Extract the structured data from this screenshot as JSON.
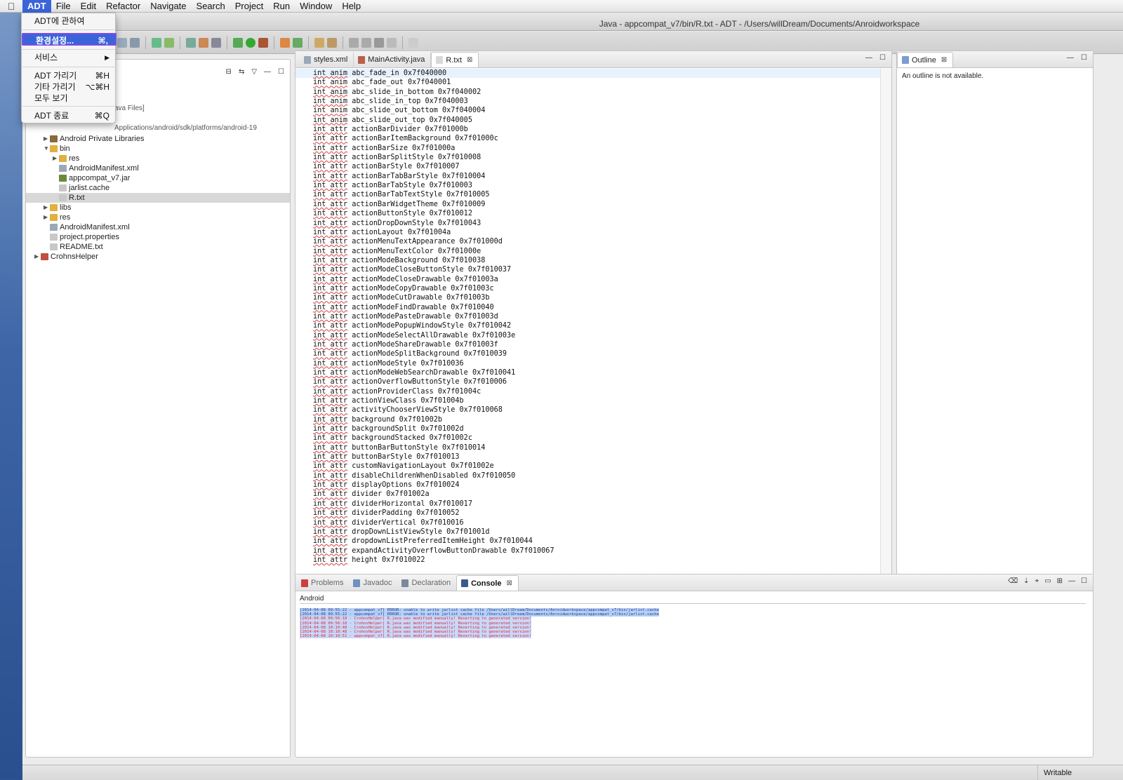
{
  "menubar": {
    "items": [
      "ADT",
      "File",
      "Edit",
      "Refactor",
      "Navigate",
      "Search",
      "Project",
      "Run",
      "Window",
      "Help"
    ]
  },
  "adt_menu": {
    "items": [
      {
        "label": "ADT에 관하여",
        "shortcut": ""
      },
      {
        "label": "환경설정...",
        "shortcut": "⌘,"
      },
      {
        "label": "서비스",
        "shortcut": "▶"
      },
      {
        "label": "ADT 가리기",
        "shortcut": "⌘H"
      },
      {
        "label": "기타 가리기",
        "shortcut": "⌥⌘H"
      },
      {
        "label": "모두 보기",
        "shortcut": ""
      },
      {
        "label": "ADT 종료",
        "shortcut": "⌘Q"
      }
    ]
  },
  "window": {
    "title": "Java - appcompat_v7/bin/R.txt - ADT - /Users/willDream/Documents/Anroidworkspace"
  },
  "explorer": {
    "partial_labels": [
      "ava Files]",
      "Applications/android/sdk/platforms/android-19"
    ],
    "tree": [
      {
        "label": "Android Private Libraries",
        "depth": 2,
        "arrow": "▶",
        "icon": "library"
      },
      {
        "label": "bin",
        "depth": 2,
        "arrow": "▼",
        "icon": "folder"
      },
      {
        "label": "res",
        "depth": 3,
        "arrow": "▶",
        "icon": "folder"
      },
      {
        "label": "AndroidManifest.xml",
        "depth": 3,
        "arrow": "",
        "icon": "xml"
      },
      {
        "label": "appcompat_v7.jar",
        "depth": 3,
        "arrow": "",
        "icon": "jar"
      },
      {
        "label": "jarlist.cache",
        "depth": 3,
        "arrow": "",
        "icon": "file"
      },
      {
        "label": "R.txt",
        "depth": 3,
        "arrow": "",
        "icon": "file",
        "selected": true
      },
      {
        "label": "libs",
        "depth": 2,
        "arrow": "▶",
        "icon": "folder"
      },
      {
        "label": "res",
        "depth": 2,
        "arrow": "▶",
        "icon": "folder"
      },
      {
        "label": "AndroidManifest.xml",
        "depth": 2,
        "arrow": "",
        "icon": "xml"
      },
      {
        "label": "project.properties",
        "depth": 2,
        "arrow": "",
        "icon": "file"
      },
      {
        "label": "README.txt",
        "depth": 2,
        "arrow": "",
        "icon": "file"
      },
      {
        "label": "CrohnsHelper",
        "depth": 1,
        "arrow": "▶",
        "icon": "project"
      }
    ]
  },
  "editor": {
    "tabs": [
      {
        "label": "styles.xml",
        "icon": "xml"
      },
      {
        "label": "MainActivity.java",
        "icon": "java"
      },
      {
        "label": "R.txt",
        "icon": "txt",
        "active": true
      }
    ],
    "lines": [
      [
        "int anim",
        "abc_fade_in 0x7f040000"
      ],
      [
        "int anim",
        "abc_fade_out 0x7f040001"
      ],
      [
        "int anim",
        "abc_slide_in_bottom 0x7f040002"
      ],
      [
        "int anim",
        "abc_slide_in_top 0x7f040003"
      ],
      [
        "int anim",
        "abc_slide_out_bottom 0x7f040004"
      ],
      [
        "int anim",
        "abc_slide_out_top 0x7f040005"
      ],
      [
        "int attr",
        "actionBarDivider 0x7f01000b"
      ],
      [
        "int attr",
        "actionBarItemBackground 0x7f01000c"
      ],
      [
        "int attr",
        "actionBarSize 0x7f01000a"
      ],
      [
        "int attr",
        "actionBarSplitStyle 0x7f010008"
      ],
      [
        "int attr",
        "actionBarStyle 0x7f010007"
      ],
      [
        "int attr",
        "actionBarTabBarStyle 0x7f010004"
      ],
      [
        "int attr",
        "actionBarTabStyle 0x7f010003"
      ],
      [
        "int attr",
        "actionBarTabTextStyle 0x7f010005"
      ],
      [
        "int attr",
        "actionBarWidgetTheme 0x7f010009"
      ],
      [
        "int attr",
        "actionButtonStyle 0x7f010012"
      ],
      [
        "int attr",
        "actionDropDownStyle 0x7f010043"
      ],
      [
        "int attr",
        "actionLayout 0x7f01004a"
      ],
      [
        "int attr",
        "actionMenuTextAppearance 0x7f01000d"
      ],
      [
        "int attr",
        "actionMenuTextColor 0x7f01000e"
      ],
      [
        "int attr",
        "actionModeBackground 0x7f010038"
      ],
      [
        "int attr",
        "actionModeCloseButtonStyle 0x7f010037"
      ],
      [
        "int attr",
        "actionModeCloseDrawable 0x7f01003a"
      ],
      [
        "int attr",
        "actionModeCopyDrawable 0x7f01003c"
      ],
      [
        "int attr",
        "actionModeCutDrawable 0x7f01003b"
      ],
      [
        "int attr",
        "actionModeFindDrawable 0x7f010040"
      ],
      [
        "int attr",
        "actionModePasteDrawable 0x7f01003d"
      ],
      [
        "int attr",
        "actionModePopupWindowStyle 0x7f010042"
      ],
      [
        "int attr",
        "actionModeSelectAllDrawable 0x7f01003e"
      ],
      [
        "int attr",
        "actionModeShareDrawable 0x7f01003f"
      ],
      [
        "int attr",
        "actionModeSplitBackground 0x7f010039"
      ],
      [
        "int attr",
        "actionModeStyle 0x7f010036"
      ],
      [
        "int attr",
        "actionModeWebSearchDrawable 0x7f010041"
      ],
      [
        "int attr",
        "actionOverflowButtonStyle 0x7f010006"
      ],
      [
        "int attr",
        "actionProviderClass 0x7f01004c"
      ],
      [
        "int attr",
        "actionViewClass 0x7f01004b"
      ],
      [
        "int attr",
        "activityChooserViewStyle 0x7f010068"
      ],
      [
        "int attr",
        "background 0x7f01002b"
      ],
      [
        "int attr",
        "backgroundSplit 0x7f01002d"
      ],
      [
        "int attr",
        "backgroundStacked 0x7f01002c"
      ],
      [
        "int attr",
        "buttonBarButtonStyle 0x7f010014"
      ],
      [
        "int attr",
        "buttonBarStyle 0x7f010013"
      ],
      [
        "int attr",
        "customNavigationLayout 0x7f01002e"
      ],
      [
        "int attr",
        "disableChildrenWhenDisabled 0x7f010050"
      ],
      [
        "int attr",
        "displayOptions 0x7f010024"
      ],
      [
        "int attr",
        "divider 0x7f01002a"
      ],
      [
        "int attr",
        "dividerHorizontal 0x7f010017"
      ],
      [
        "int attr",
        "dividerPadding 0x7f010052"
      ],
      [
        "int attr",
        "dividerVertical 0x7f010016"
      ],
      [
        "int attr",
        "dropDownListViewStyle 0x7f01001d"
      ],
      [
        "int attr",
        "dropdownListPreferredItemHeight 0x7f010044"
      ],
      [
        "int attr",
        "expandActivityOverflowButtonDrawable 0x7f010067"
      ],
      [
        "int attr",
        "height 0x7f010022"
      ]
    ]
  },
  "outline": {
    "tab_label": "Outline",
    "message": "An outline is not available."
  },
  "bottom": {
    "tabs": [
      {
        "label": "Problems",
        "icon": "problems"
      },
      {
        "label": "Javadoc",
        "icon": "javadoc"
      },
      {
        "label": "Declaration",
        "icon": "declaration"
      },
      {
        "label": "Console",
        "icon": "console",
        "active": true
      }
    ],
    "console_title": "Android",
    "console_lines": [
      {
        "text": "[2014-04-08 09:55:22 - appcompat_v7] ERROR: unable to write jarlist cache file /Users/willDream/Documents/Anroidworkspace/appcompat_v7/bin/jarlist.cache",
        "kind": "blue"
      },
      {
        "text": "[2014-04-08 09:55:22 - appcompat_v7] ERROR: unable to write jarlist cache file /Users/willDream/Documents/Anroidworkspace/appcompat_v7/bin/jarlist.cache",
        "kind": "blue"
      },
      {
        "text": "[2014-04-08 09:56:18 - CrohnsHelper] R.java was modified manually! Reverting to generated version!",
        "kind": "red"
      },
      {
        "text": "[2014-04-08 09:56:18 - CrohnsHelper] R.java was modified manually! Reverting to generated version!",
        "kind": "red"
      },
      {
        "text": "[2014-04-08 10:10:48 - CrohnsHelper] R.java was modified manually! Reverting to generated version!",
        "kind": "red"
      },
      {
        "text": "[2014-04-08 10:10:48 - CrohnsHelper] R.java was modified manually! Reverting to generated version!",
        "kind": "red"
      },
      {
        "text": "[2014-04-08 10:10:51 - appcompat_v7] R.java was modified manually! Reverting to generated version!",
        "kind": "red"
      }
    ]
  },
  "status": {
    "writable": "Writable"
  },
  "colors": {
    "menu_highlight": "#3b64d8",
    "selection_border": "#7d4ce6",
    "console_error": "#e0283c",
    "console_info": "#1b3f8f"
  }
}
